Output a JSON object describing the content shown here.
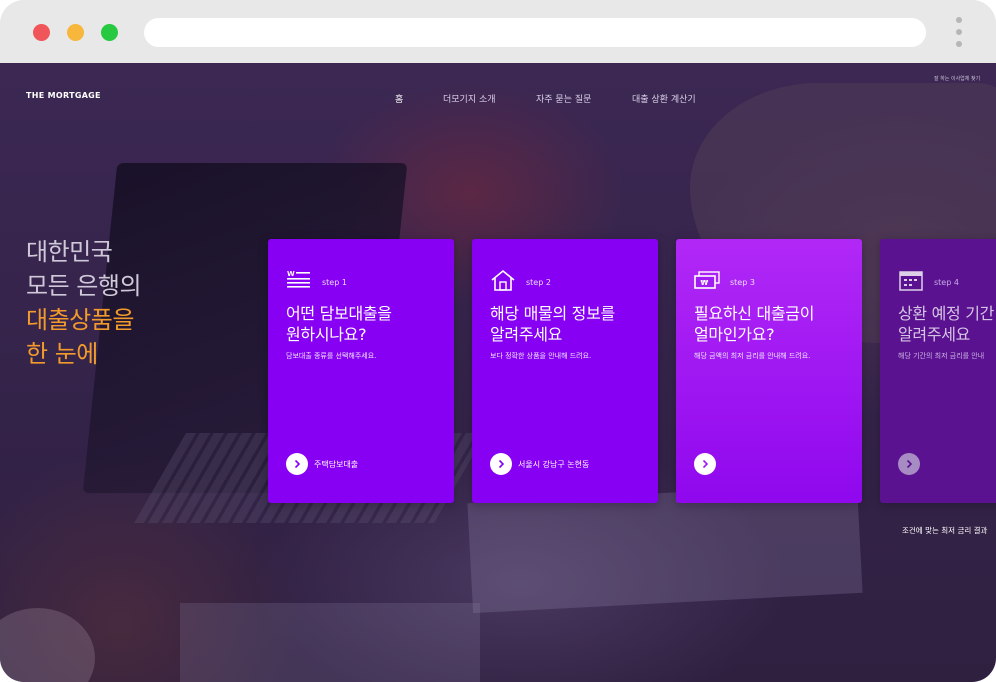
{
  "browser": {
    "url": ""
  },
  "header": {
    "logo": "THE MORTGAGE",
    "nav": [
      "홈",
      "더모기지 소개",
      "자주 묻는 질문",
      "대출 상환 계산기"
    ],
    "login": "잘 하는 이사업체 찾기"
  },
  "hero": {
    "line1": "대한민국",
    "line2": "모든 은행의",
    "line3": "대출상품을",
    "line4": "한 눈에"
  },
  "cards": [
    {
      "step": "step 1",
      "icon": "document-lines-icon",
      "title1": "어떤 담보대출을",
      "title2": "원하시나요?",
      "desc": "담보대출 종류를 선택해주세요.",
      "action": "주택담보대출"
    },
    {
      "step": "step 2",
      "icon": "house-icon",
      "title1": "해당 매물의 정보를",
      "title2": "알려주세요",
      "desc": "보다 정확한 상품을 안내해 드려요.",
      "action": "서울시 강남구 논현동"
    },
    {
      "step": "step 3",
      "icon": "money-bills-icon",
      "title1": "필요하신 대출금이",
      "title2": "얼마인가요?",
      "desc": "해당 금액의 최저 금리를 안내해 드려요.",
      "action": ""
    },
    {
      "step": "step 4",
      "icon": "calendar-icon",
      "title1": "상환 예정 기간",
      "title2": "알려주세요",
      "desc": "해당 기간의 최저 금리를 안내",
      "action": ""
    }
  ],
  "result_link": "조건에 맞는 최저 금리 결과",
  "colors": {
    "card": "#8800f4",
    "card_highlight": "#b128f6",
    "accent": "#f39a2c"
  }
}
